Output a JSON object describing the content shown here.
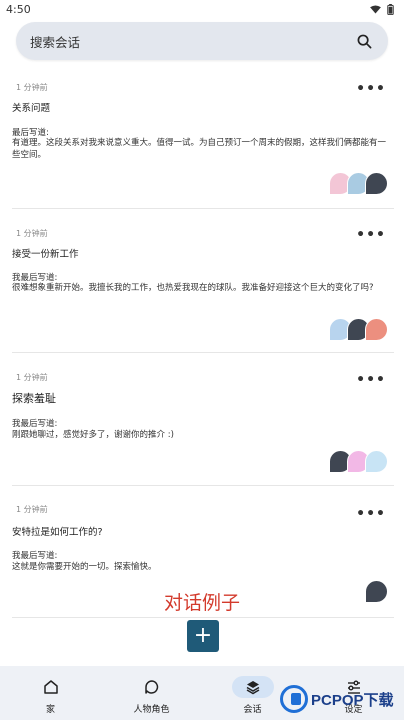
{
  "status": {
    "time": "4:50"
  },
  "search": {
    "placeholder": "搜索会话"
  },
  "conversations": [
    {
      "time": "1 分钟前",
      "title": "关系问题",
      "label": "最后写道:",
      "message": "有道理。这段关系对我来说意义重大。值得一试。为自己预订一个周末的假期，这样我们俩都能有一些空间。",
      "avatars": [
        "#f3c6d6",
        "#a9cbe2",
        "#3f4652"
      ]
    },
    {
      "time": "1 分钟前",
      "title": "接受一份新工作",
      "label": "我最后写道:",
      "message": "很难想象重新开始。我擅长我的工作，也热爱我现在的球队。我准备好迎接这个巨大的变化了吗?",
      "avatars": [
        "#b8d4ee",
        "#3f4652",
        "#ec8f7f"
      ]
    },
    {
      "time": "1 分钟前",
      "title": "探索羞耻",
      "label": "我最后写道:",
      "message": "刚跟她聊过，感觉好多了，谢谢你的推介 :)",
      "avatars": [
        "#3f4652",
        "#f2b8e6",
        "#c8e4f5"
      ]
    },
    {
      "time": "1 分钟前",
      "title": "安特拉是如何工作的?",
      "label": "我最后写道:",
      "message": "这就是你需要开始的一切。探索愉快。",
      "avatars": [
        "#3f4652"
      ]
    }
  ],
  "promo": {
    "text": "对话例子"
  },
  "fab": {
    "label": "+"
  },
  "nav": [
    {
      "label": "家",
      "icon": "home-icon"
    },
    {
      "label": "人物角色",
      "icon": "chat-bubble-icon"
    },
    {
      "label": "会话",
      "icon": "layers-icon",
      "active": true
    },
    {
      "label": "设定",
      "icon": "sliders-icon"
    }
  ],
  "watermark": {
    "text": "PCPOP下载"
  }
}
